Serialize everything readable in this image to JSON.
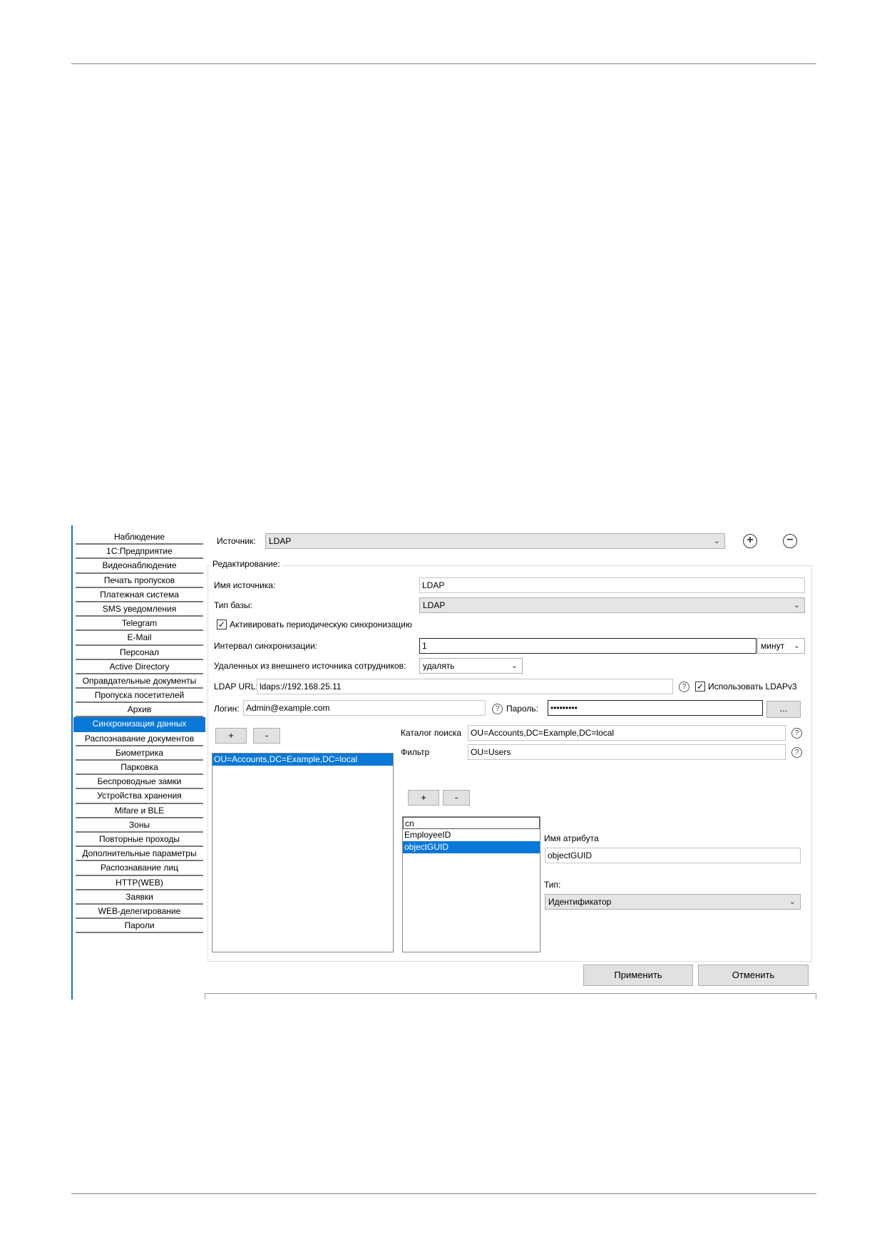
{
  "sidebar": {
    "items": [
      "Наблюдение",
      "1С:Предприятие",
      "Видеонаблюдение",
      "Печать пропусков",
      "Платежная система",
      "SMS уведомления",
      "Telegram",
      "E-Mail",
      "Персонал",
      "Active Directory",
      "Оправдательные документы",
      "Пропуска посетителей",
      "Архив",
      "Синхронизация данных",
      "Распознавание документов",
      "Биометрика",
      "Парковка",
      "Беспроводные замки",
      "Устройства хранения",
      "Mifare и BLE",
      "Зоны",
      "Повторные проходы",
      "Дополнительные параметры",
      "Распознавание лиц",
      "HTTP(WEB)",
      "Заявки",
      "WEB-делегирование",
      "Пароли"
    ],
    "active_index": 13
  },
  "source": {
    "label": "Источник:",
    "value": "LDAP"
  },
  "edit": {
    "legend": "Редактирование:",
    "name_label": "Имя источника:",
    "name_value": "LDAP",
    "dbtype_label": "Тип базы:",
    "dbtype_value": "LDAP",
    "periodic_label": "Активировать периодическую синхронизацию",
    "interval_label": "Интервал синхронизации:",
    "interval_value": "1",
    "interval_unit": "минут",
    "deleted_label": "Удаленных из внешнего источника сотрудников:",
    "deleted_value": "удалять",
    "url_label": "LDAP URL:",
    "url_value": "ldaps://192.168.25.11",
    "ldapv3_label": "Использовать LDAPv3",
    "login_label": "Логин:",
    "login_value": "Admin@example.com",
    "password_label": "Пароль:",
    "password_value": "•••••••••",
    "browse_label": "...",
    "add_label": "+",
    "remove_label": "-",
    "catalogs": [
      "OU=Accounts,DC=Example,DC=local"
    ],
    "search_label": "Каталог поиска",
    "search_value": "OU=Accounts,DC=Example,DC=local",
    "filter_label": "Фильтр",
    "filter_value": "OU=Users",
    "attributes": [
      "cn",
      "EmployeeID",
      "objectGUID"
    ],
    "attr_name_label": "Имя атрибута",
    "attr_name_value": "objectGUID",
    "type_label": "Тип:",
    "type_value": "Идентификатор"
  },
  "actions": {
    "apply": "Применить",
    "cancel": "Отменить"
  }
}
